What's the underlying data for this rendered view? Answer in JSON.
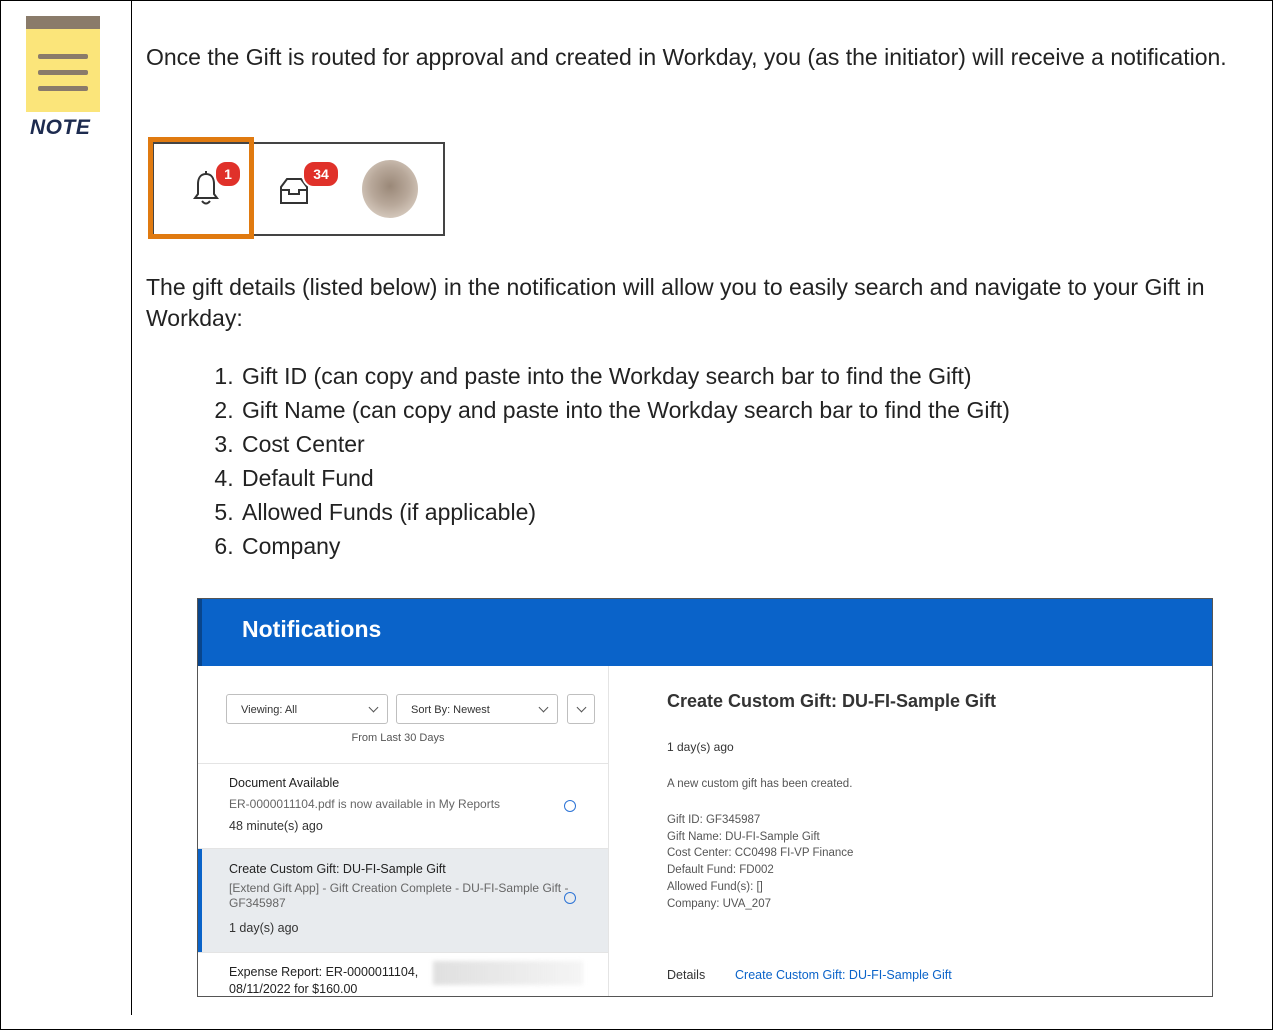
{
  "note": {
    "label": "NOTE",
    "icon": "notepad-icon"
  },
  "intro_text": "Once the Gift is routed for approval and created in Workday, you (as the initiator) will receive a notification.",
  "header_icons": {
    "notifications_count": "1",
    "inbox_count": "34",
    "colors": {
      "highlight": "#e07a10",
      "badge": "#e0312a"
    }
  },
  "details_text": "The gift details (listed below) in the notification will allow you to easily search and navigate to your Gift in Workday:",
  "steps": [
    "Gift ID (can copy and paste into the Workday search bar to find the Gift)",
    "Gift Name (can copy and paste into the Workday search bar to find the Gift)",
    "Cost Center",
    "Default Fund",
    "Allowed Funds (if applicable)",
    "Company"
  ],
  "notifications": {
    "title": "Notifications",
    "viewing": "Viewing: All",
    "sort": "Sort By: Newest",
    "range": "From Last 30 Days",
    "items": [
      {
        "title": "Document Available",
        "text": "ER-0000011104.pdf is now available in My Reports",
        "time": "48 minute(s) ago"
      },
      {
        "title": "Create Custom Gift: DU-FI-Sample Gift",
        "text": "[Extend Gift App] - Gift Creation Complete - DU-FI-Sample Gift - GF345987",
        "time": "1 day(s) ago"
      },
      {
        "title": "Expense Report: ER-0000011104,",
        "title2": "08/11/2022 for $160.00"
      }
    ],
    "detail": {
      "title": "Create Custom Gift: DU-FI-Sample Gift",
      "ago": "1 day(s) ago",
      "intro": "A new custom gift has been created.",
      "fields": [
        "Gift ID: GF345987",
        "Gift Name: DU-FI-Sample Gift",
        "Cost Center: CC0498 FI-VP Finance",
        "Default Fund: FD002",
        "Allowed Fund(s): []",
        "Company: UVA_207"
      ],
      "details_label": "Details",
      "details_link": "Create Custom Gift: DU-FI-Sample Gift"
    },
    "colors": {
      "header": "#0a63c9"
    }
  }
}
